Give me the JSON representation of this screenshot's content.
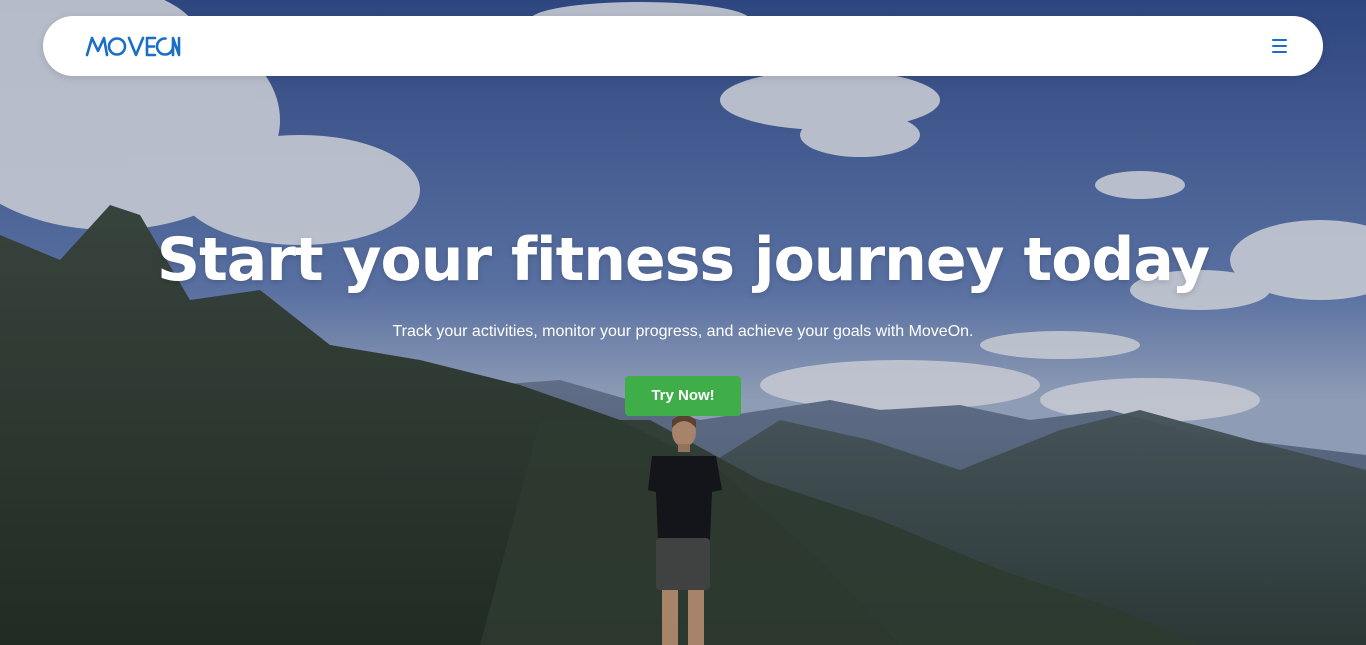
{
  "navbar": {
    "logo_text": "MOVEON",
    "menu_icon": "hamburger-menu-icon",
    "brand_color": "#1a6fc4"
  },
  "hero": {
    "title": "Start your fitness journey today",
    "subtitle": "Track your activities, monitor your progress, and achieve your goals with MoveOn.",
    "cta_label": "Try Now!",
    "cta_color": "#3fae49",
    "background_image": "mountain-landscape-with-hiker"
  }
}
